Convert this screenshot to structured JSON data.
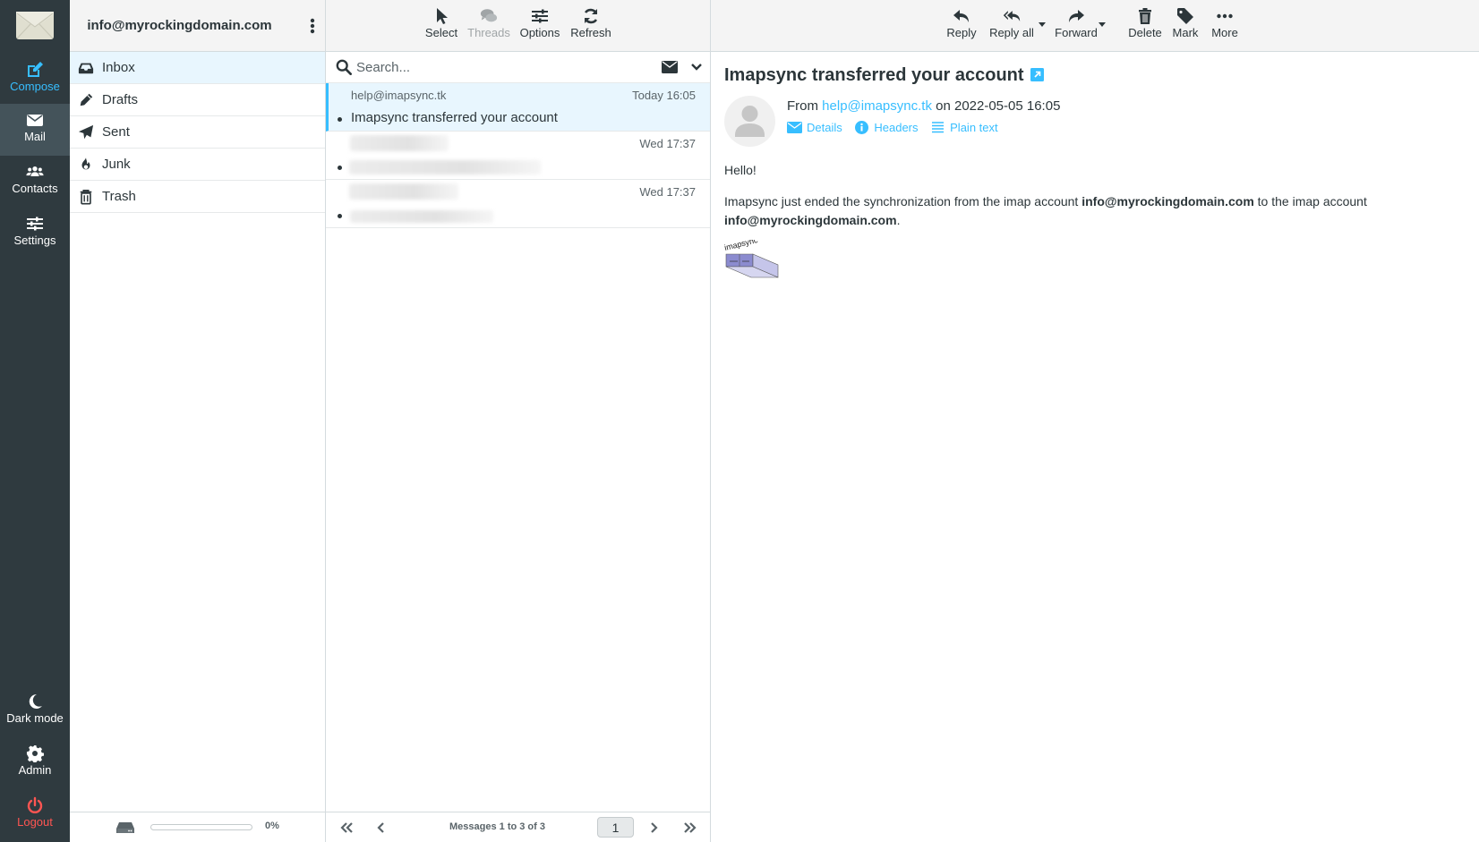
{
  "nav": {
    "logo": "envelope-logo",
    "items": [
      {
        "id": "compose",
        "label": "Compose",
        "icon": "compose-icon"
      },
      {
        "id": "mail",
        "label": "Mail",
        "icon": "mail-icon",
        "active": true
      },
      {
        "id": "contacts",
        "label": "Contacts",
        "icon": "contacts-icon"
      },
      {
        "id": "settings",
        "label": "Settings",
        "icon": "settings-icon"
      }
    ],
    "bottom_items": [
      {
        "id": "dark-mode",
        "label": "Dark mode",
        "icon": "moon-icon"
      },
      {
        "id": "admin",
        "label": "Admin",
        "icon": "gear-icon"
      },
      {
        "id": "logout",
        "label": "Logout",
        "icon": "power-icon"
      }
    ]
  },
  "folders": {
    "account": "info@myrockingdomain.com",
    "items": [
      {
        "label": "Inbox",
        "icon": "inbox-icon",
        "selected": true
      },
      {
        "label": "Drafts",
        "icon": "pencil-icon"
      },
      {
        "label": "Sent",
        "icon": "paper-plane-icon"
      },
      {
        "label": "Junk",
        "icon": "fire-icon"
      },
      {
        "label": "Trash",
        "icon": "trash-icon"
      }
    ],
    "quota": {
      "percent": 0,
      "label": "0%"
    }
  },
  "list": {
    "toolbar": [
      {
        "label": "Select",
        "icon": "pointer-icon"
      },
      {
        "label": "Threads",
        "icon": "comments-icon",
        "disabled": true
      },
      {
        "label": "Options",
        "icon": "sliders-icon"
      },
      {
        "label": "Refresh",
        "icon": "refresh-icon"
      }
    ],
    "search_placeholder": "Search...",
    "messages": [
      {
        "from": "help@imapsync.tk",
        "date": "Today 16:05",
        "subject": "Imapsync transferred your account",
        "selected": true
      },
      {
        "from": "",
        "date": "Wed 17:37",
        "subject": "",
        "redacted": true
      },
      {
        "from": "",
        "date": "Wed 17:37",
        "subject": "",
        "redacted": true
      }
    ],
    "pagination": {
      "text": "Messages 1 to 3 of 3",
      "page": "1"
    }
  },
  "reader": {
    "toolbar": [
      {
        "label": "Reply",
        "icon": "reply-icon"
      },
      {
        "label": "Reply all",
        "icon": "reply-all-icon",
        "dropdown": true
      },
      {
        "label": "Forward",
        "icon": "forward-icon",
        "dropdown": true
      },
      {
        "label": "Delete",
        "icon": "trash-icon"
      },
      {
        "label": "Mark",
        "icon": "tag-icon"
      },
      {
        "label": "More",
        "icon": "ellipsis-icon"
      }
    ],
    "subject": "Imapsync transferred your account",
    "from_prefix": "From",
    "from_email": "help@imapsync.tk",
    "date_text": "on 2022-05-05 16:05",
    "header_links": [
      {
        "label": "Details",
        "icon": "envelope-icon"
      },
      {
        "label": "Headers",
        "icon": "info-icon"
      },
      {
        "label": "Plain text",
        "icon": "lines-icon"
      }
    ],
    "body": {
      "greeting": "Hello!",
      "line_start": "Imapsync just ended the synchronization from the imap account ",
      "source_account": "info@myrockingdomain.com",
      "line_middle": " to the imap account ",
      "target_account": "info@myrockingdomain.com",
      "line_end": ".",
      "image_alt": "imapsync"
    }
  },
  "colors": {
    "accent": "#37beff",
    "nav_bg": "#2f3a3f",
    "nav_active": "#44535a",
    "logout": "#ff5552",
    "selected_bg": "#e8f6fe"
  }
}
